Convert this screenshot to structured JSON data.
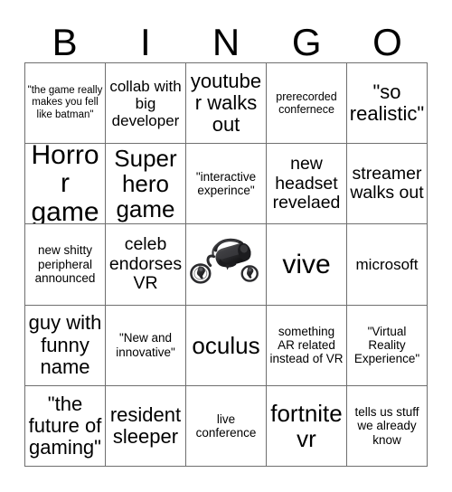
{
  "card": {
    "title_letters": [
      "B",
      "I",
      "N",
      "G",
      "O"
    ],
    "rows": [
      [
        {
          "text": "\"the game really makes you fell like batman\"",
          "size": "fs-11"
        },
        {
          "text": "collab with big developer",
          "size": "fs-17"
        },
        {
          "text": "youtuber walks out",
          "size": "fs-22"
        },
        {
          "text": "prerecorded confernece",
          "size": "fs-12"
        },
        {
          "text": "\"so realistic\"",
          "size": "fs-22"
        }
      ],
      [
        {
          "text": "Horror game",
          "size": "fs-30"
        },
        {
          "text": "Super hero game",
          "size": "fs-26"
        },
        {
          "text": "\"interactive experince\"",
          "size": "fs-13"
        },
        {
          "text": "new headset revelaed",
          "size": "fs-19"
        },
        {
          "text": "streamer walks out",
          "size": "fs-19"
        }
      ],
      [
        {
          "text": "new shitty peripheral announced",
          "size": "fs-13"
        },
        {
          "text": "celeb endorses VR",
          "size": "fs-19"
        },
        {
          "text": "",
          "size": "fs-15",
          "icon": "vr-headset-image"
        },
        {
          "text": "vive",
          "size": "fs-30"
        },
        {
          "text": "microsoft",
          "size": "fs-17"
        }
      ],
      [
        {
          "text": "guy with funny name",
          "size": "fs-22"
        },
        {
          "text": "\"New and innovative\"",
          "size": "fs-13"
        },
        {
          "text": "oculus",
          "size": "fs-26"
        },
        {
          "text": "something AR related instead of VR",
          "size": "fs-13"
        },
        {
          "text": "\"Virtual Reality Experience\"",
          "size": "fs-13"
        }
      ],
      [
        {
          "text": "\"the future of gaming\"",
          "size": "fs-22"
        },
        {
          "text": "resident sleeper",
          "size": "fs-22"
        },
        {
          "text": "live conference",
          "size": "fs-13"
        },
        {
          "text": "fortnite vr",
          "size": "fs-26"
        },
        {
          "text": "tells us stuff we already know",
          "size": "fs-13"
        }
      ]
    ],
    "free_space": {
      "icon": "vr-headset-image",
      "description": "VR headset with two hand controllers"
    },
    "colors": {
      "background": "#ffffff",
      "text": "#000000",
      "gridline": "#6f6f6f"
    }
  }
}
